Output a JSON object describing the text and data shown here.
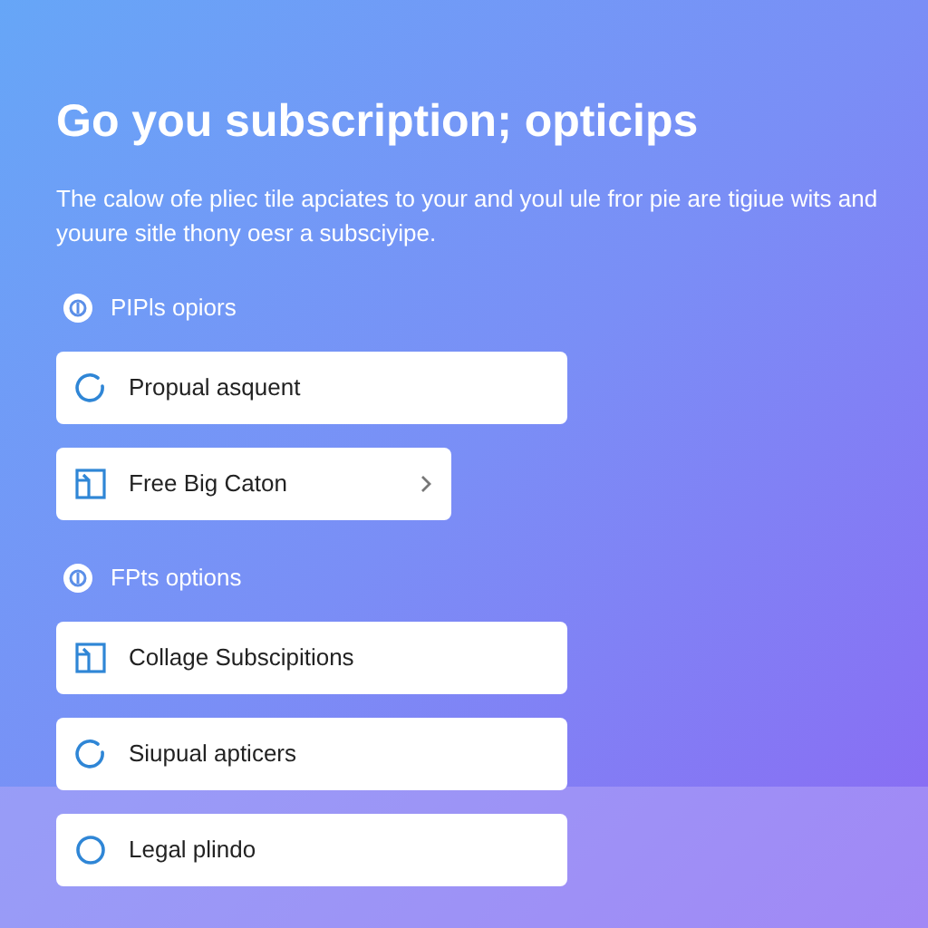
{
  "title": "Go you subscription; opticips",
  "description": "The calow ofe pliec tile apciates to your and youl ule fror pie are tigiue wits and youure sitle thony oesr a subsciyipe.",
  "sections": [
    {
      "heading": "PIPls opiors",
      "items": [
        {
          "label": "Propual asquent",
          "kind": "ring",
          "chevron": false
        },
        {
          "label": "Free Big Caton",
          "kind": "frame",
          "chevron": true
        }
      ]
    },
    {
      "heading": "FPts options",
      "items": [
        {
          "label": "Collage Subscipitions",
          "kind": "frame",
          "chevron": false
        },
        {
          "label": "Siupual apticers",
          "kind": "ring",
          "chevron": false
        },
        {
          "label": "Legal plindo",
          "kind": "circle",
          "chevron": false
        }
      ]
    }
  ]
}
